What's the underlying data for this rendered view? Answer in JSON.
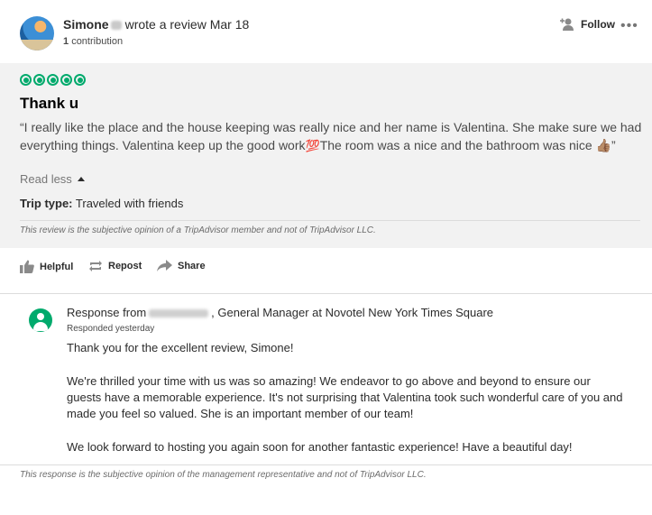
{
  "reviewer": {
    "name": "Simone",
    "wrote_text": "wrote a review Mar 18",
    "contrib_count": "1",
    "contrib_label": "contribution"
  },
  "header_actions": {
    "follow_label": "Follow",
    "more_label": "•••"
  },
  "review": {
    "rating": 5,
    "title": "Thank u",
    "body_part1": "“I really like the place and the house keeping was really nice and her name is Valentina. She make sure we had everything things. Valentina keep up the good work",
    "emoji_100": "💯",
    "body_part2": "The room was a nice and the bathroom was nice ",
    "emoji_thumb": "👍🏽",
    "body_part3": "”",
    "read_less": "Read less",
    "trip_type_label": "Trip type:",
    "trip_type_value": "Traveled with friends",
    "disclaimer": "This review is the subjective opinion of a TripAdvisor member and not of TripAdvisor LLC."
  },
  "actions": {
    "helpful": "Helpful",
    "repost": "Repost",
    "share": "Share"
  },
  "response": {
    "from_prefix": "Response from",
    "from_suffix": ", General Manager at Novotel New York Times Square",
    "when": "Responded yesterday",
    "paragraphs": [
      "Thank you for the excellent review, Simone!",
      "We're thrilled your time with us was so amazing! We endeavor to go above and beyond to ensure our guests have a memorable experience. It's not surprising that Valentina took such wonderful care of you and made you feel so valued. She is an important member of our team!",
      "We look forward to hosting you again soon for another fantastic experience! Have a beautiful day!"
    ],
    "disclaimer": "This response is the subjective opinion of the management representative and not of TripAdvisor LLC."
  },
  "colors": {
    "accent_green": "#00aa6c",
    "card_bg": "#f2f2f2"
  }
}
